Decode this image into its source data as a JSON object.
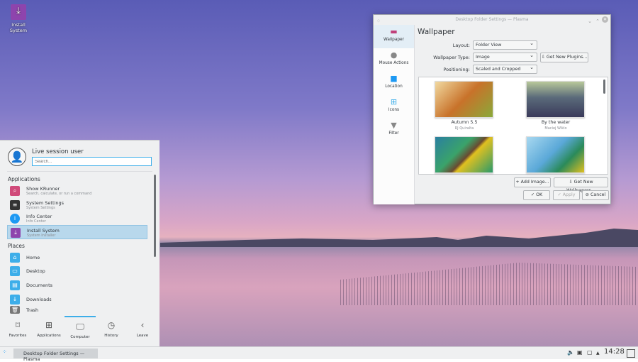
{
  "desktop": {
    "icon_label": "Install System"
  },
  "launcher": {
    "user": "Live session user",
    "search_placeholder": "Search...",
    "applications_header": "Applications",
    "apps": [
      {
        "name": "Show KRunner",
        "desc": "Search, calculate, or run a command"
      },
      {
        "name": "System Settings",
        "desc": "System Settings"
      },
      {
        "name": "Info Center",
        "desc": "Info Center"
      },
      {
        "name": "Install System",
        "desc": "System Installer"
      }
    ],
    "places_header": "Places",
    "places": [
      "Home",
      "Desktop",
      "Documents",
      "Downloads",
      "Trash"
    ],
    "tabs": [
      "Favorites",
      "Applications",
      "Computer",
      "History",
      "Leave"
    ],
    "active_tab": "Computer"
  },
  "taskbar": {
    "task": "Desktop Folder Settings — Plasma",
    "clock": "14:28"
  },
  "dialog": {
    "title": "Desktop Folder Settings — Plasma",
    "sidebar": [
      "Wallpaper",
      "Mouse Actions",
      "Location",
      "Icons",
      "Filter"
    ],
    "heading": "Wallpaper",
    "layout_label": "Layout:",
    "layout_value": "Folder View",
    "type_label": "Wallpaper Type:",
    "type_value": "Image",
    "get_plugins": "Get New Plugins...",
    "positioning_label": "Positioning:",
    "positioning_value": "Scaled and Cropped",
    "wallpapers": [
      {
        "name": "Autumn 5.5",
        "author": "RJ Quiralta"
      },
      {
        "name": "By the water",
        "author": "Maciej Wiklo"
      }
    ],
    "add_image": "Add Image...",
    "get_wallpapers": "Get New Wallpapers...",
    "ok": "OK",
    "apply": "Apply",
    "cancel": "Cancel"
  }
}
